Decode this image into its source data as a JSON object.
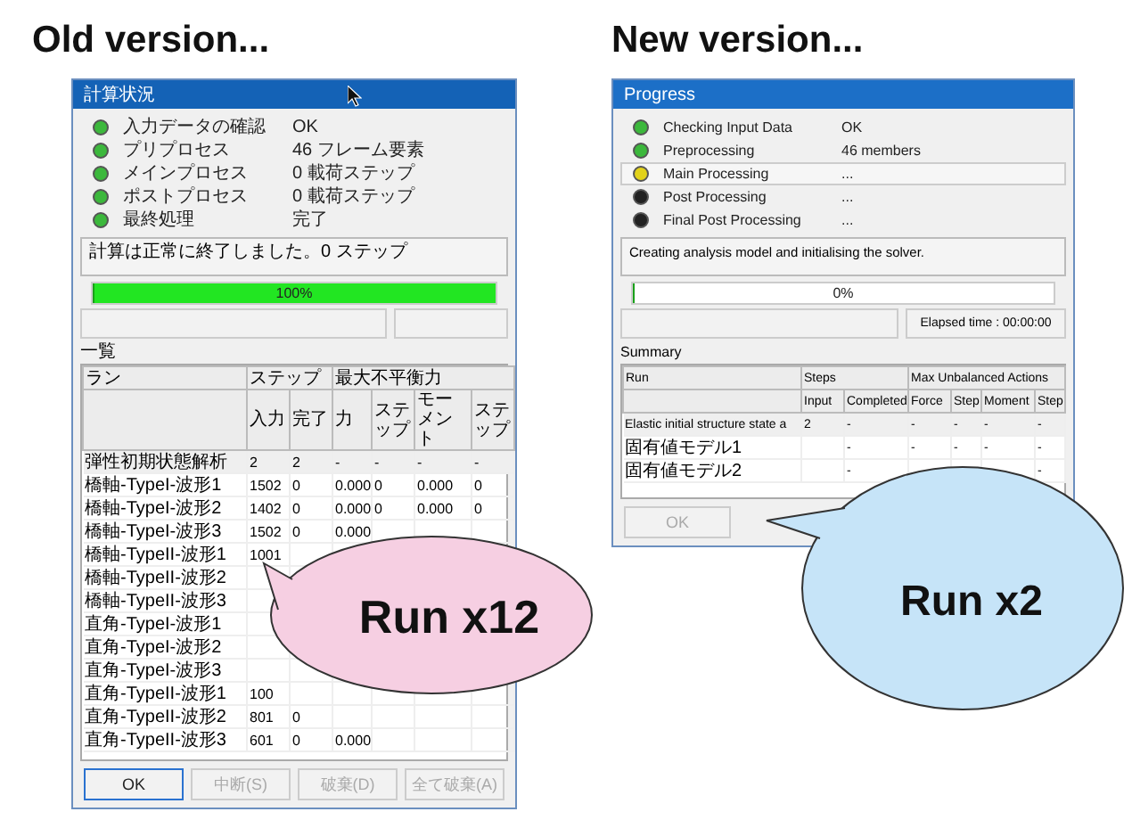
{
  "panels": [
    {
      "heading": "Old version...",
      "dialog": {
        "title": "計算状況",
        "cursor": true,
        "steps": [
          {
            "label": "入力データの確認",
            "value": "OK",
            "color": "#3cb83c"
          },
          {
            "label": "プリプロセス",
            "value": "46 フレーム要素",
            "color": "#3cb83c"
          },
          {
            "label": "メインプロセス",
            "value": "0 載荷ステップ",
            "color": "#3cb83c"
          },
          {
            "label": "ポストプロセス",
            "value": "0 載荷ステップ",
            "color": "#3cb83c"
          },
          {
            "label": "最終処理",
            "value": "完了",
            "color": "#3cb83c"
          }
        ],
        "message": "計算は正常に終了しました。0 ステップ",
        "progress": {
          "level": 1,
          "label": "100%"
        },
        "list_label": "一覧",
        "table": {
          "groups": [
            {
              "label": "ラン"
            },
            {
              "label": "ステップ",
              "columns": [
                "入力",
                "完了"
              ]
            },
            {
              "label": "最大不平衡力",
              "columns": [
                "力",
                "ステップ",
                "モーメント",
                "ステップ"
              ]
            }
          ],
          "rows": [
            {
              "name": "弾性初期状態解析",
              "values": {
                "input": "2",
                "completed": "2",
                "force": "-",
                "force_step": "-",
                "moment": "-",
                "moment_step": "-"
              }
            },
            {
              "name": "橋軸-TypeI-波形1",
              "values": {
                "input": "1502",
                "completed": "0",
                "force": "0.000",
                "force_step": "0",
                "moment": "0.000",
                "moment_step": "0"
              }
            },
            {
              "name": "橋軸-TypeI-波形2",
              "values": {
                "input": "1402",
                "completed": "0",
                "force": "0.000",
                "force_step": "0",
                "moment": "0.000",
                "moment_step": "0"
              }
            },
            {
              "name": "橋軸-TypeI-波形3",
              "values": {
                "input": "1502",
                "completed": "0",
                "force": "0.000"
              }
            },
            {
              "name": "橋軸-TypeII-波形1",
              "values": {
                "input": "1001"
              }
            },
            {
              "name": "橋軸-TypeII-波形2"
            },
            {
              "name": "橋軸-TypeII-波形3"
            },
            {
              "name": "直角-TypeI-波形1"
            },
            {
              "name": "直角-TypeI-波形2"
            },
            {
              "name": "直角-TypeI-波形3"
            },
            {
              "name": "直角-TypeII-波形1",
              "values": {
                "input": "100"
              }
            },
            {
              "name": "直角-TypeII-波形2",
              "values": {
                "input": "801",
                "completed": "0"
              }
            },
            {
              "name": "直角-TypeII-波形3",
              "values": {
                "input": "601",
                "completed": "0",
                "force": "0.000"
              }
            }
          ]
        },
        "buttons": [
          {
            "label": "OK",
            "disabled": false
          },
          {
            "label": "中断(S)",
            "disabled": true
          },
          {
            "label": "破棄(D)",
            "disabled": true
          },
          {
            "label": "全て破棄(A)",
            "disabled": true
          }
        ]
      },
      "callout": {
        "text": "Run x12",
        "color": "#f6cfe2"
      }
    },
    {
      "heading": "New version...",
      "dialog": {
        "title": "Progress",
        "steps": [
          {
            "label": "Checking Input Data",
            "value": "OK",
            "color": "#3cb83c",
            "selected": false
          },
          {
            "label": "Preprocessing",
            "value": "46 members",
            "color": "#3cb83c",
            "selected": false
          },
          {
            "label": "Main Processing",
            "value": "...",
            "color": "#e2d21a",
            "selected": true
          },
          {
            "label": "Post Processing",
            "value": "...",
            "color": "#222222",
            "selected": false
          },
          {
            "label": "Final Post Processing",
            "value": "...",
            "color": "#222222",
            "selected": false
          }
        ],
        "message": "Creating analysis model and initialising the solver.",
        "progress": {
          "level": 0,
          "label": "0%"
        },
        "elapsed": "Elapsed time : 00:00:00",
        "list_label": "Summary",
        "table": {
          "groups": [
            {
              "label": "Run"
            },
            {
              "label": "Steps",
              "columns": [
                "Input",
                "Completed"
              ]
            },
            {
              "label": "Max Unbalanced Actions",
              "columns": [
                "Force",
                "Step",
                "Moment",
                "Step"
              ]
            }
          ],
          "rows": [
            {
              "name": "Elastic initial structure state a",
              "values": {
                "input": "2",
                "completed": "-",
                "force": "-",
                "force_step": "-",
                "moment": "-",
                "moment_step": "-"
              }
            },
            {
              "name": "固有値モデル1",
              "values": {
                "completed": "-",
                "force": "-",
                "force_step": "-",
                "moment": "-",
                "moment_step": "-"
              }
            },
            {
              "name": "固有値モデル2",
              "values": {
                "completed": "-",
                "moment_step": "-"
              }
            }
          ]
        },
        "buttons": [
          {
            "label": "OK",
            "disabled": true
          }
        ]
      },
      "callout": {
        "text": "Run x2",
        "color": "#c6e4f8"
      }
    }
  ]
}
